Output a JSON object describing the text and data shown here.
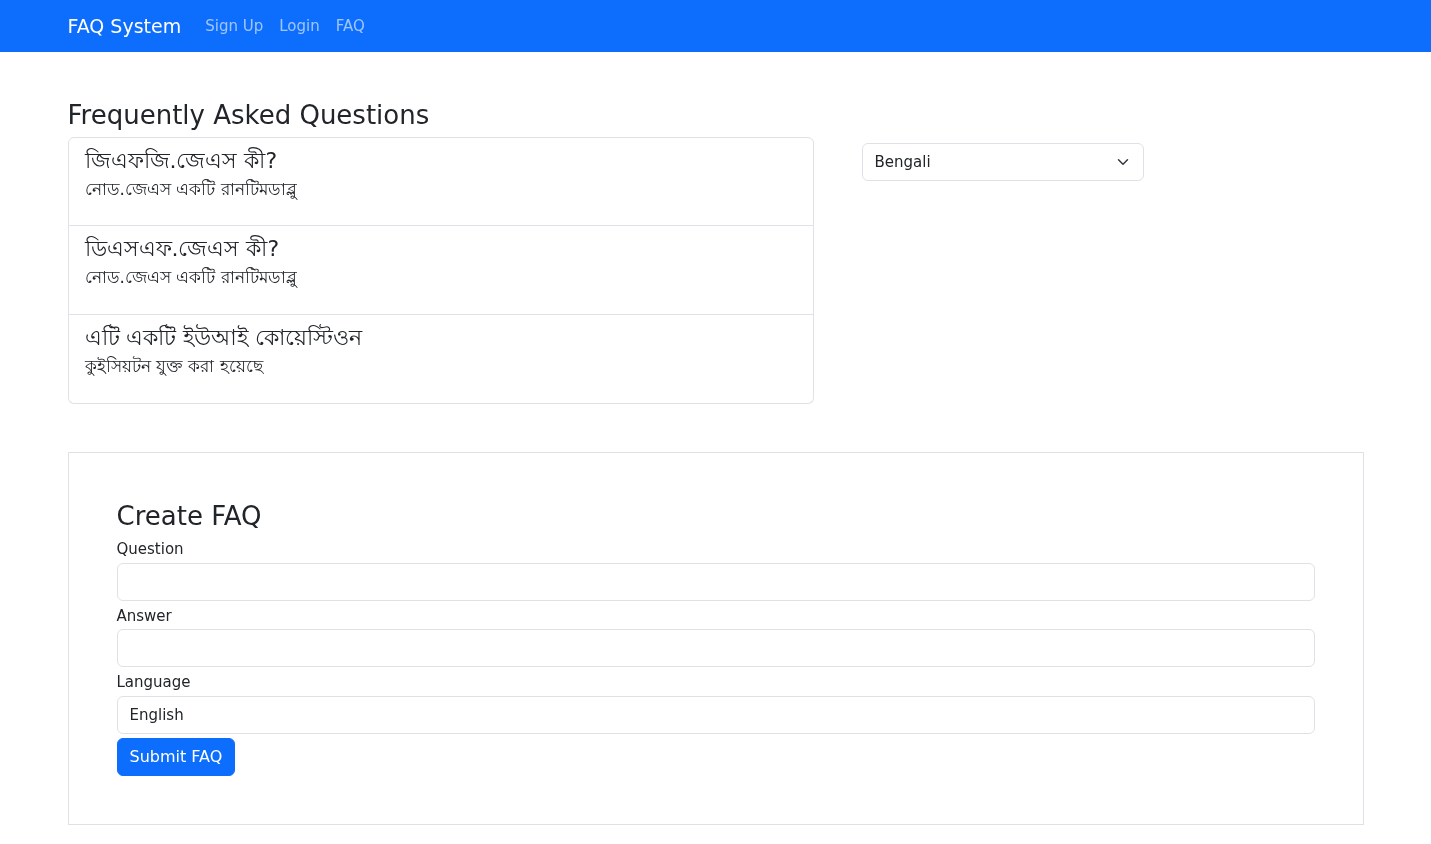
{
  "navbar": {
    "brand": "FAQ System",
    "links": [
      {
        "label": "Sign Up",
        "selected": false
      },
      {
        "label": "Login",
        "selected": false
      },
      {
        "label": "FAQ",
        "selected": false
      }
    ]
  },
  "faq_section": {
    "title": "Frequently Asked Questions",
    "language_select": {
      "value": "Bengali"
    },
    "items": [
      {
        "question": "জিএফজি.জেএস কী?",
        "answer": "নোড.জেএস একটি রানটিমডাব্লু"
      },
      {
        "question": "ডিএসএফ.জেএস কী?",
        "answer": "নোড.জেএস একটি রানটিমডাব্লু"
      },
      {
        "question": "এটি একটি ইউআই কোয়েস্টিওন",
        "answer": "কুইসিয়টন যুক্ত করা হয়েছে"
      }
    ]
  },
  "create_form": {
    "title": "Create FAQ",
    "fields": [
      {
        "label": "Question"
      },
      {
        "label": "Answer"
      },
      {
        "label": "Language",
        "value": "English"
      }
    ],
    "submit": "Submit FAQ"
  }
}
